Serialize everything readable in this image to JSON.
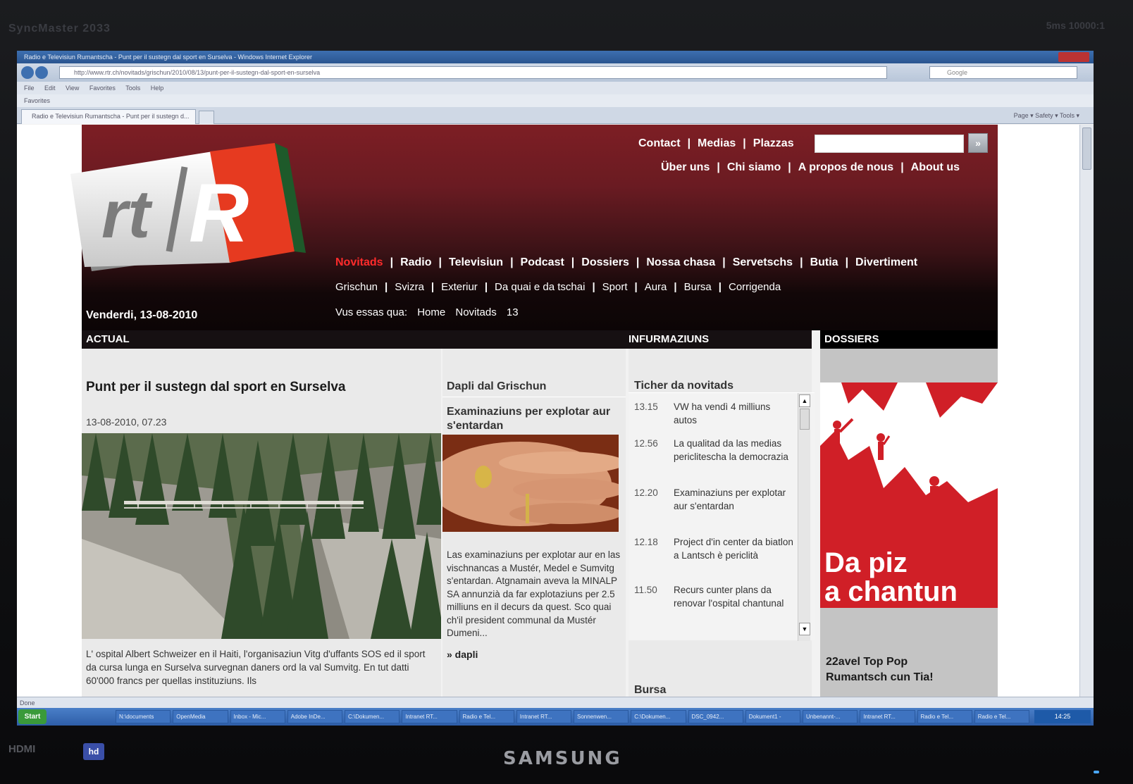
{
  "monitor": {
    "model_label": "SyncMaster 2033",
    "top_right_label": "5ms  10000:1",
    "brand": "SAMSUNG",
    "hdmi_label": "HDMI",
    "badge_label": "hd"
  },
  "browser": {
    "window_title": "Radio e Televisiun Rumantscha - Punt per il sustegn dal sport en Surselva - Windows Internet Explorer",
    "address": "http://www.rtr.ch/novitads/grischun/2010/08/13/punt-per-il-sustegn-dal-sport-en-surselva",
    "search_placeholder": "Google",
    "menu": "File  Edit  View  Favorites  Tools  Help",
    "favorites_label": "Favorites",
    "tab_title": "Radio e Televisiun Rumantscha - Punt per il sustegn d...",
    "command_bar": "Page ▾  Safety ▾  Tools ▾",
    "status_text": "Done"
  },
  "header": {
    "logo_text_left": "rt",
    "logo_text_right": "R",
    "top_links": [
      "Contact",
      "Medias",
      "Plazzas"
    ],
    "search_button": "»",
    "lang_links": [
      "Über uns",
      "Chi siamo",
      "A propos de nous",
      "About us"
    ],
    "main_nav": [
      "Novitads",
      "Radio",
      "Televisiun",
      "Podcast",
      "Dossiers",
      "Nossa chasa",
      "Servetschs",
      "Butia",
      "Divertiment"
    ],
    "sub_nav": [
      "Grischun",
      "Svizra",
      "Exteriur",
      "Da quai e da tschai",
      "Sport",
      "Aura",
      "Bursa",
      "Corrigenda"
    ],
    "breadcrumb_label": "Vus essas qua:",
    "breadcrumb": [
      "Home",
      "Novitads",
      "13"
    ],
    "date": "Venderdi, 13-08-2010"
  },
  "columns": {
    "actual": "ACTUAL",
    "infurmaziuns": "INFURMAZIUNS",
    "dossiers": "DOSSIERS"
  },
  "actual": {
    "headline": "Punt per il sustegn dal sport en Surselva",
    "timestamp": "13-08-2010, 07.23",
    "teaser": "L' ospital Albert Schweizer en il Haiti, l'organisaziun Vitg d'uffants SOS ed il sport da cursa lunga en Surselva survegnan daners ord la val Sumvitg. En tut datti 60'000 francs per quellas instituziuns. Ils"
  },
  "grischun": {
    "title": "Dapli dal Grischun",
    "headline": "Examinaziuns per explotar aur s'entardan",
    "text": "Las examinaziuns per explotar aur en las vischnancas a Mustér, Medel e Sumvitg s'entardan. Atgnamain aveva la MINALP SA annunzià da far explotaziuns per 2.5 milliuns en il decurs da quest. Sco quai ch'il president communal da Mustér Dumeni...",
    "more": "» dapli"
  },
  "infurmaziuns": {
    "ticker_title": "Ticher da novitads",
    "ticker": [
      {
        "time": "13.15",
        "text": "VW ha vendì 4 milliuns autos"
      },
      {
        "time": "12.56",
        "text": "La qualitad da las medias periclitescha la democrazia"
      },
      {
        "time": "12.20",
        "text": "Examinaziuns per explotar aur s'entardan"
      },
      {
        "time": "12.18",
        "text": "Project d'in center da biatlon a Lantsch è periclità"
      },
      {
        "time": "11.50",
        "text": "Recurs cunter plans da renovar l'ospital chantunal"
      }
    ],
    "scroll_up": "▲",
    "scroll_down": "▼",
    "bursa": "Bursa"
  },
  "dossiers": {
    "poster_title_line1": "Da piz",
    "poster_title_line2": "a chantun",
    "caption_line1": "22avel Top Pop",
    "caption_line2": "Rumantsch cun Tia!"
  },
  "taskbar": {
    "start": "Start",
    "items": [
      "N:\\documents",
      "OpenMedia",
      "Inbox - Mic...",
      "Adobe InDe...",
      "C:\\Dokumen...",
      "Intranet RT...",
      "Radio e Tel...",
      "Intranet RT...",
      "Sonnenwen...",
      "C:\\Dokumen...",
      "DSC_0942...",
      "Dokument1 -",
      "Unbenannt-...",
      "Intranet RT...",
      "Radio e Tel...",
      "Radio e Tel..."
    ],
    "clock": "14:25"
  },
  "colors": {
    "header_red": "#7d1e24",
    "active_nav": "#ff2b2b",
    "poster_red": "#d01f27",
    "column_head": "#161012"
  }
}
